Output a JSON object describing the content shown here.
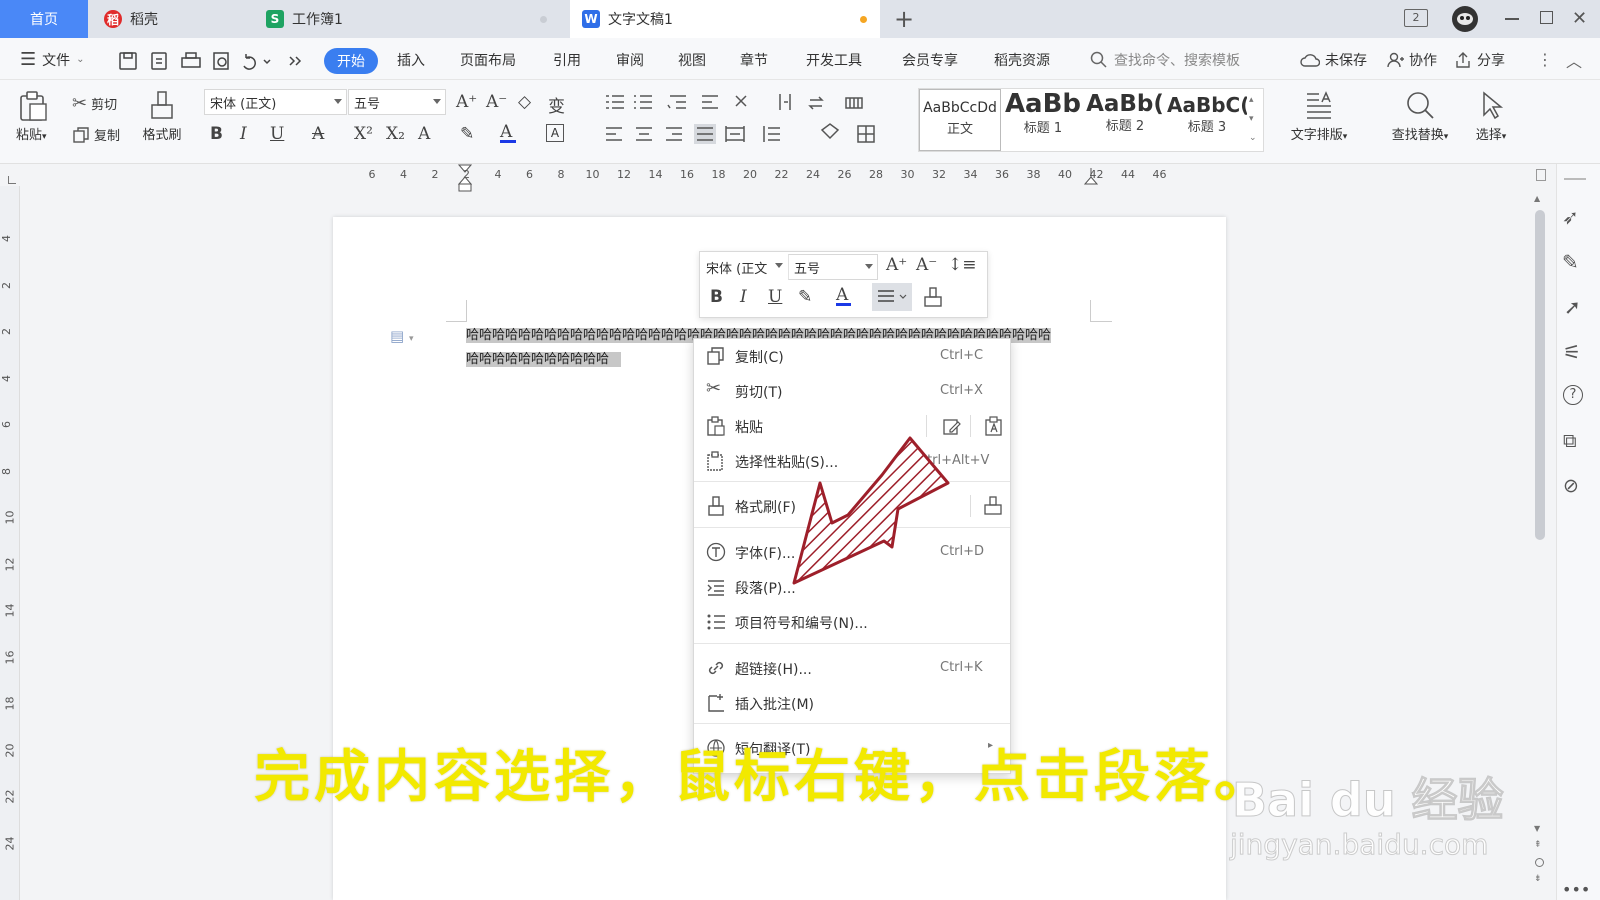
{
  "tabs": [
    {
      "label": "首页",
      "active": false
    },
    {
      "label": "稻壳",
      "icon": "daoke-app-icon",
      "icon_color": "#e02b2b"
    },
    {
      "label": "工作簿1",
      "icon": "spreadsheet-app-icon",
      "icon_letter": "S",
      "icon_color": "#1ea362"
    },
    {
      "label": "文字文稿1",
      "icon": "writer-app-icon",
      "icon_letter": "W",
      "icon_color": "#2f6ee8",
      "active": true
    }
  ],
  "new_tab_label": "+",
  "window": {
    "page_badge": "2"
  },
  "menu": {
    "file_label": "文件",
    "items": [
      "开始",
      "插入",
      "页面布局",
      "引用",
      "审阅",
      "视图",
      "章节",
      "开发工具",
      "会员专享",
      "稻壳资源"
    ],
    "active": "开始",
    "search_placeholder": "查找命令、搜索模板",
    "unsaved": "未保存",
    "collaborate": "协作",
    "share": "分享"
  },
  "ribbon": {
    "paste": "粘贴",
    "cut": "剪切",
    "copy": "复制",
    "format_painter": "格式刷",
    "font_name": "宋体 (正文)",
    "font_size": "五号",
    "styles": [
      {
        "preview": "AaBbCcDd",
        "name": "正文"
      },
      {
        "preview": "AaBb",
        "name": "标题 1"
      },
      {
        "preview": "AaBb(",
        "name": "标题 2"
      },
      {
        "preview": "AaBbC(",
        "name": "标题 3"
      }
    ],
    "text_layout": "文字排版",
    "find_replace": "查找替换",
    "select": "选择"
  },
  "ruler": {
    "h_labels": [
      "6",
      "4",
      "2",
      "2",
      "4",
      "6",
      "8",
      "10",
      "12",
      "14",
      "16",
      "18",
      "20",
      "22",
      "24",
      "26",
      "28",
      "30",
      "32",
      "34",
      "36",
      "38",
      "40",
      "42",
      "44",
      "46"
    ],
    "v_labels": [
      "4",
      "2",
      "2",
      "4",
      "6",
      "8",
      "10",
      "12",
      "14",
      "16",
      "18",
      "20",
      "22",
      "24"
    ]
  },
  "document": {
    "line1": "哈哈哈哈哈哈哈哈哈哈哈哈哈哈哈哈哈哈哈哈哈哈哈哈哈哈哈哈哈哈哈哈哈哈哈哈哈哈哈哈哈哈哈哈哈",
    "line2": "哈哈哈哈哈哈哈哈哈哈哈"
  },
  "mini_toolbar": {
    "font_name": "宋体 (正文",
    "font_size": "五号"
  },
  "context_menu": {
    "items": [
      {
        "label": "复制(C)",
        "shortcut": "Ctrl+C",
        "icon": "copy-icon"
      },
      {
        "label": "剪切(T)",
        "shortcut": "Ctrl+X",
        "icon": "scissors-icon"
      },
      {
        "label": "粘贴",
        "shortcut": "",
        "icon": "paste-icon"
      },
      {
        "label": "选择性粘贴(S)...",
        "shortcut": "Ctrl+Alt+V",
        "icon": "paste-special-icon"
      },
      {
        "label": "格式刷(F)",
        "shortcut": "",
        "icon": "format-painter-icon"
      },
      {
        "label": "字体(F)...",
        "shortcut": "Ctrl+D",
        "icon": "font-icon"
      },
      {
        "label": "段落(P)...",
        "shortcut": "",
        "icon": "paragraph-icon"
      },
      {
        "label": "项目符号和编号(N)...",
        "shortcut": "",
        "icon": "bullets-icon"
      },
      {
        "label": "超链接(H)...",
        "shortcut": "Ctrl+K",
        "icon": "link-icon"
      },
      {
        "label": "插入批注(M)",
        "shortcut": "",
        "icon": "comment-icon"
      },
      {
        "label": "短句翻译(T)",
        "shortcut": "",
        "icon": "translate-icon"
      }
    ]
  },
  "overlay": {
    "caption": "完成内容选择，鼠标右键，点击段落。",
    "watermark_logo": "Bai du 经验",
    "watermark_url": "jingyan.baidu.com",
    "arrow_color": "#9e1f2a",
    "caption_color": "#f2e900"
  }
}
